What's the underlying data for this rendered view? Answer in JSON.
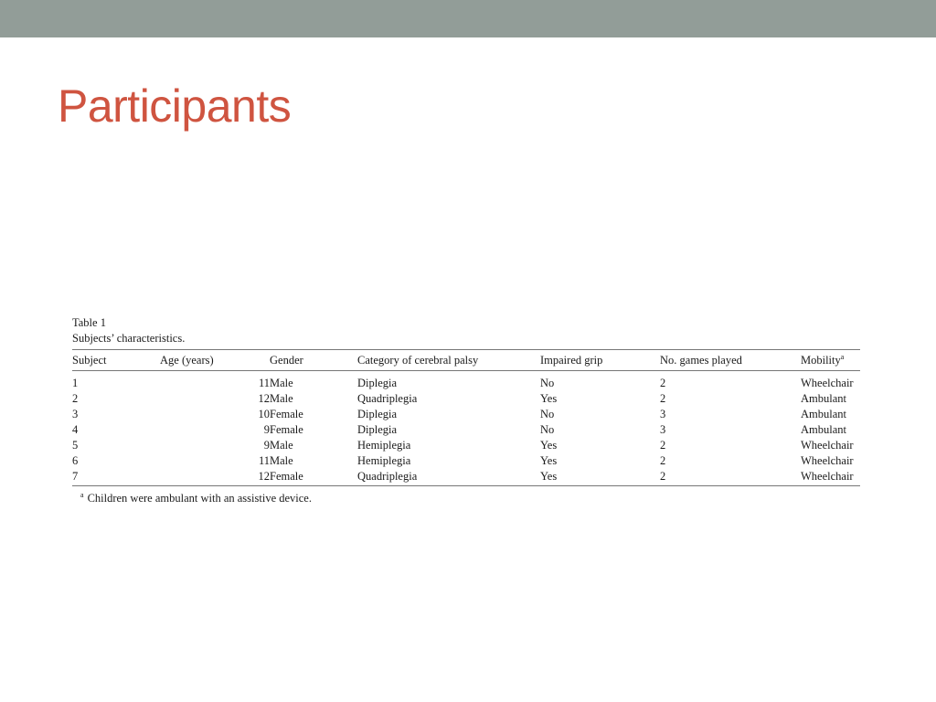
{
  "slide": {
    "title": "Participants",
    "top_bar_color": "#929d98",
    "title_color": "#cf5440"
  },
  "table": {
    "label": "Table 1",
    "title": "Subjects’ characteristics.",
    "headers": {
      "subject": "Subject",
      "age": "Age (years)",
      "gender": "Gender",
      "category": "Category of cerebral palsy",
      "grip": "Impaired grip",
      "games": "No. games played",
      "mobility": "Mobility",
      "mobility_note_marker": "a"
    },
    "rows": [
      {
        "subject": "1",
        "age": "11",
        "gender": "Male",
        "category": "Diplegia",
        "grip": "No",
        "games": "2",
        "mobility": "Wheelchair"
      },
      {
        "subject": "2",
        "age": "12",
        "gender": "Male",
        "category": "Quadriplegia",
        "grip": "Yes",
        "games": "2",
        "mobility": "Ambulant"
      },
      {
        "subject": "3",
        "age": "10",
        "gender": "Female",
        "category": "Diplegia",
        "grip": "No",
        "games": "3",
        "mobility": "Ambulant"
      },
      {
        "subject": "4",
        "age": "9",
        "gender": "Female",
        "category": "Diplegia",
        "grip": "No",
        "games": "3",
        "mobility": "Ambulant"
      },
      {
        "subject": "5",
        "age": "9",
        "gender": "Male",
        "category": "Hemiplegia",
        "grip": "Yes",
        "games": "2",
        "mobility": "Wheelchair"
      },
      {
        "subject": "6",
        "age": "11",
        "gender": "Male",
        "category": "Hemiplegia",
        "grip": "Yes",
        "games": "2",
        "mobility": "Wheelchair"
      },
      {
        "subject": "7",
        "age": "12",
        "gender": "Female",
        "category": "Quadriplegia",
        "grip": "Yes",
        "games": "2",
        "mobility": "Wheelchair"
      }
    ],
    "footnote": {
      "marker": "a",
      "text": "Children were ambulant with an assistive device."
    }
  }
}
